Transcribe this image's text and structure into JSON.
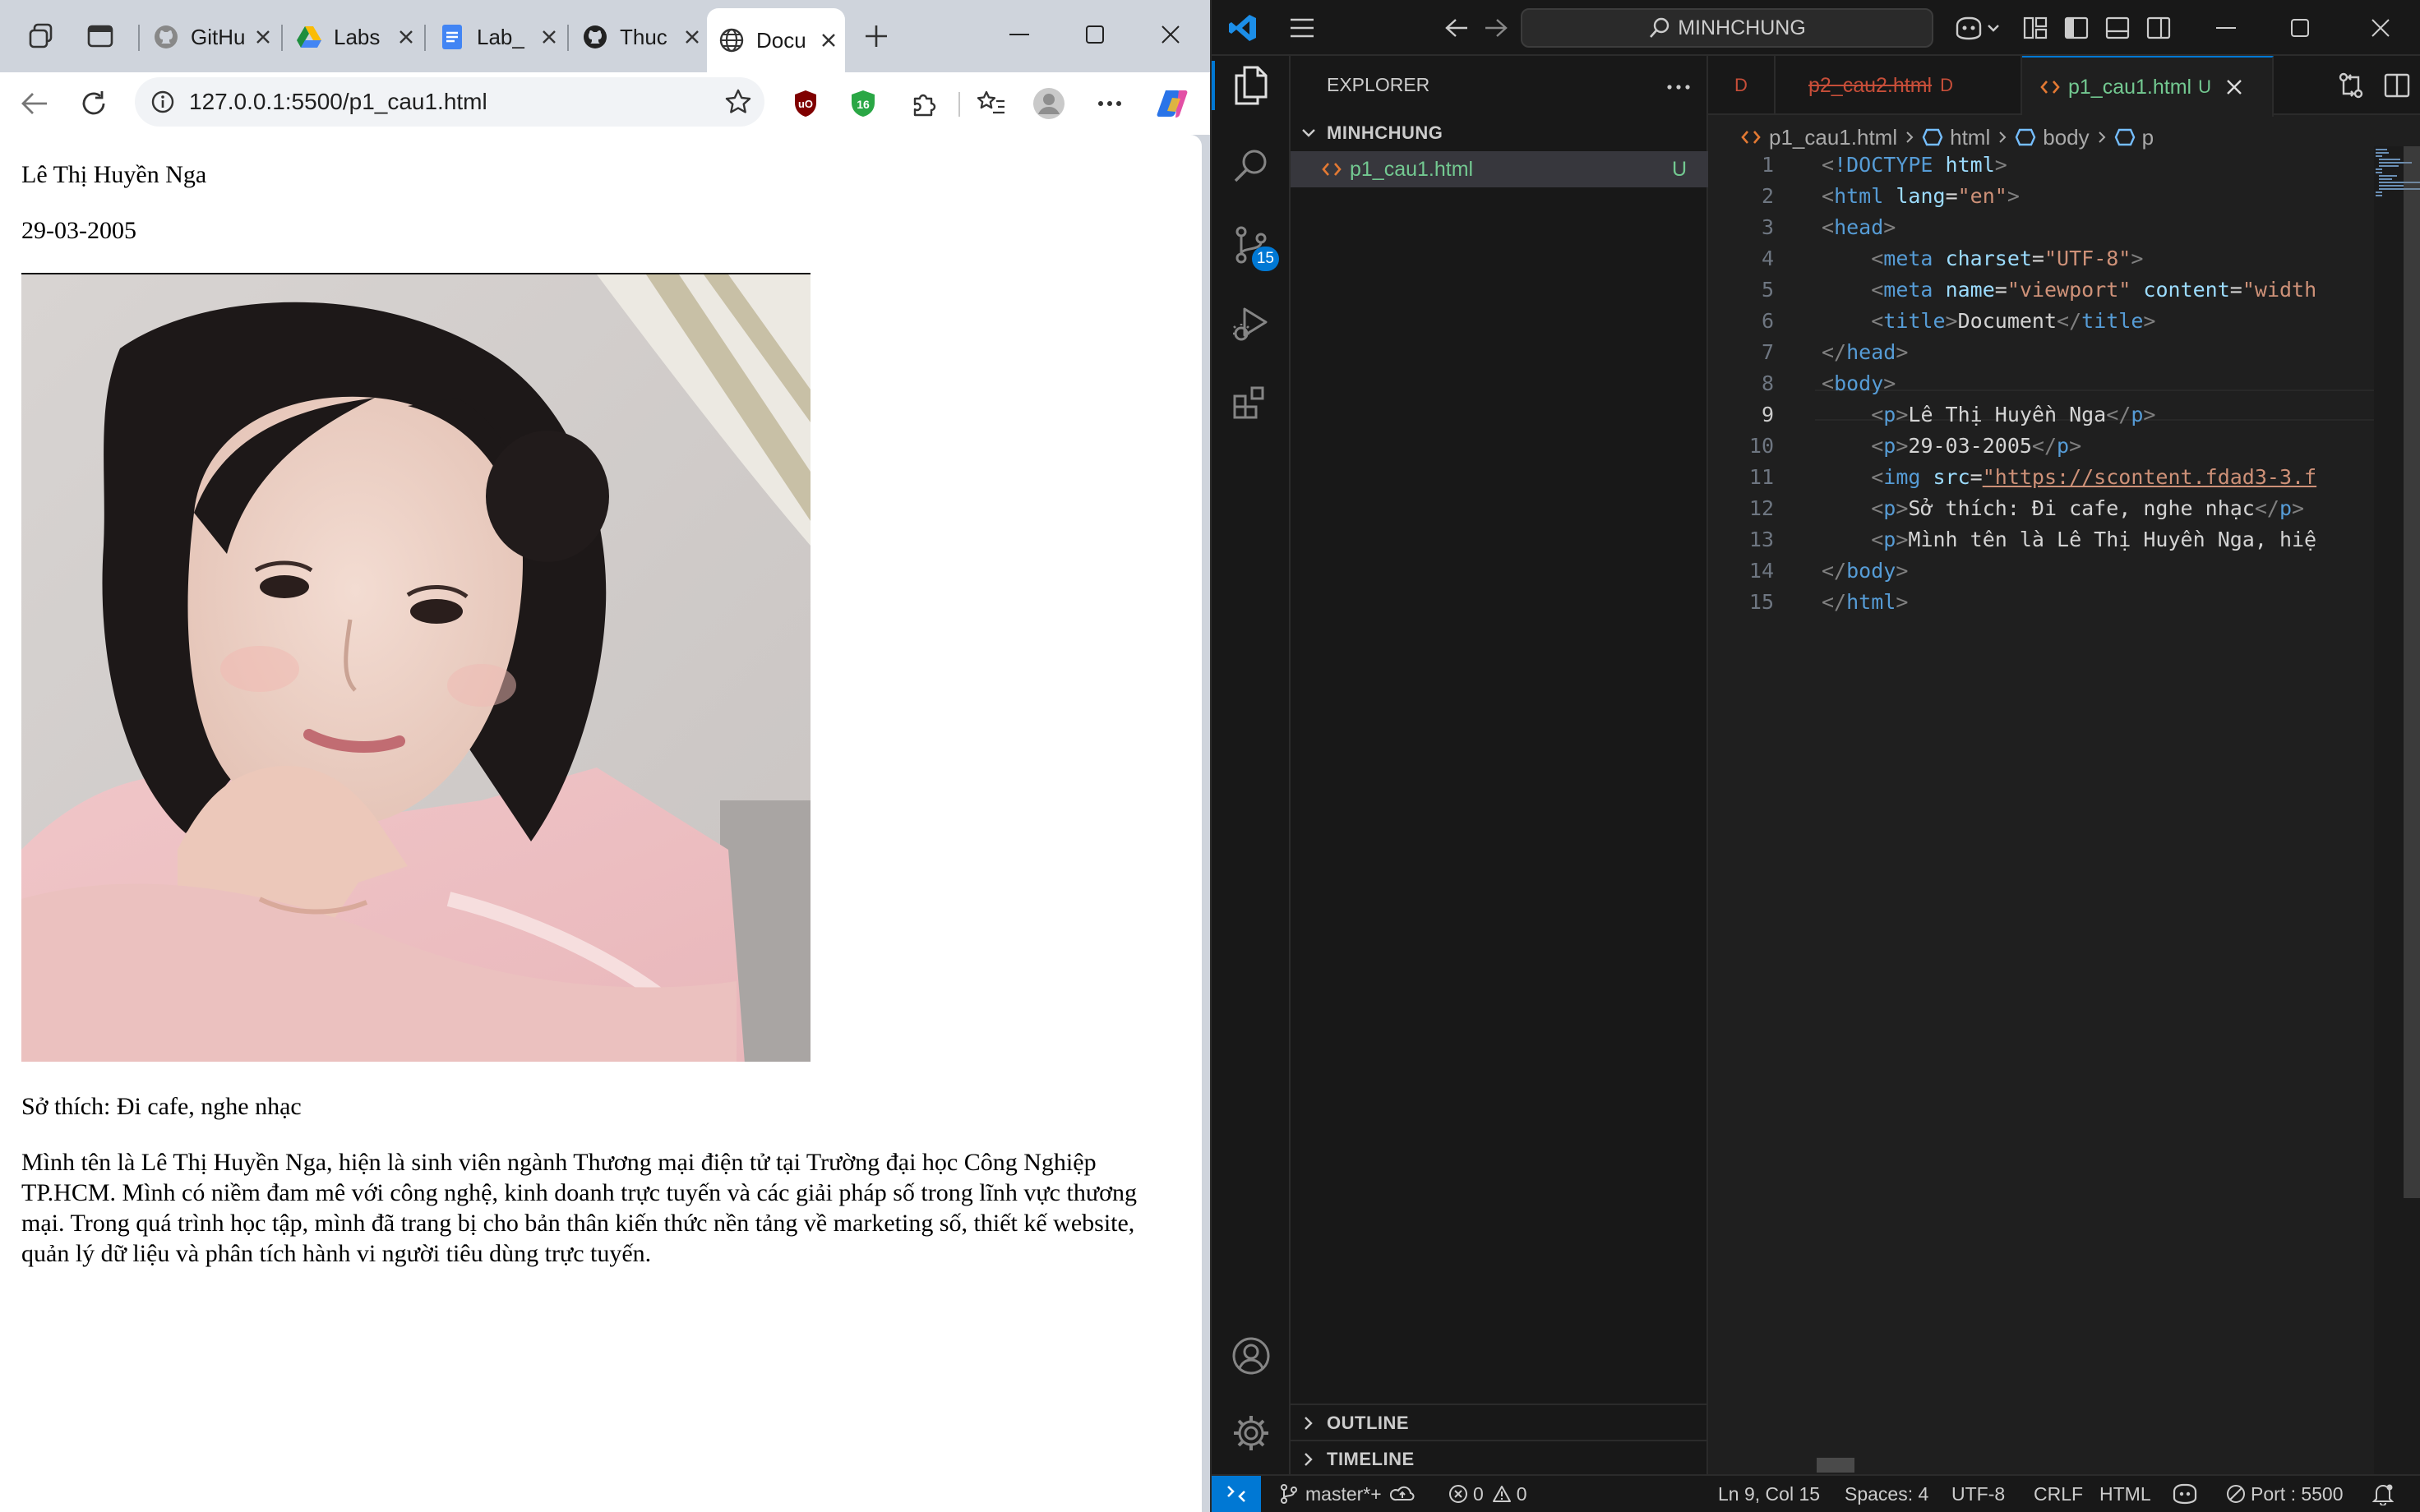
{
  "browser": {
    "tabs": [
      {
        "label": "GitHub",
        "icon": "github-icon"
      },
      {
        "label": "Labs",
        "icon": "google-drive-icon"
      },
      {
        "label": "Lab_",
        "icon": "google-docs-icon"
      },
      {
        "label": "Thuc",
        "icon": "github-icon"
      },
      {
        "label": "Docu",
        "icon": "globe-icon",
        "active": true
      }
    ],
    "address": "127.0.0.1:5500/p1_cau1.html",
    "extension_badge": "16",
    "page": {
      "name": "Lê Thị Huyền Nga",
      "dob": "29-03-2005",
      "hobby": "Sở thích: Đi cafe, nghe nhạc",
      "intro": "Mình tên là Lê Thị Huyền Nga, hiện là sinh viên ngành Thương mại điện tử tại Trường đại học Công Nghiệp TP.HCM. Mình có niềm đam mê với công nghệ, kinh doanh trực tuyến và các giải pháp số trong lĩnh vực thương mại. Trong quá trình học tập, mình đã trang bị cho bản thân kiến thức nền tảng về marketing số, thiết kế website, quản lý dữ liệu và phân tích hành vi người tiêu dùng trực tuyến."
    }
  },
  "vscode": {
    "command_center": "MINHCHUNG",
    "scm_badge": "15",
    "explorer": {
      "title": "EXPLORER",
      "folder": "MINHCHUNG",
      "file": {
        "name": "p1_cau1.html",
        "status": "U"
      },
      "outline": "OUTLINE",
      "timeline": "TIMELINE"
    },
    "tabs": [
      {
        "label": "D",
        "status": ""
      },
      {
        "label": "p2_cau2.html",
        "status": "D"
      },
      {
        "label": "p1_cau1.html",
        "status": "U"
      }
    ],
    "breadcrumb": [
      "p1_cau1.html",
      "html",
      "body",
      "p"
    ],
    "code_lines": [
      "1",
      "2",
      "3",
      "4",
      "5",
      "6",
      "7",
      "8",
      "9",
      "10",
      "11",
      "12",
      "13",
      "14",
      "15"
    ],
    "code_text": {
      "l9": "Lê Thị Huyền Nga",
      "l10": "29-03-2005",
      "l11_url": "\"https://scontent.fdad3-3.f",
      "l12": "Sở thích: Đi cafe, nghe nhạc",
      "l13": "Mình tên là Lê Thị Huyền Nga, hiệ"
    },
    "status": {
      "branch": "master*+",
      "errors": "0",
      "warnings": "0",
      "position": "Ln 9, Col 15",
      "spaces": "Spaces: 4",
      "encoding": "UTF-8",
      "eol": "CRLF",
      "language": "HTML",
      "port": "Port : 5500"
    }
  }
}
